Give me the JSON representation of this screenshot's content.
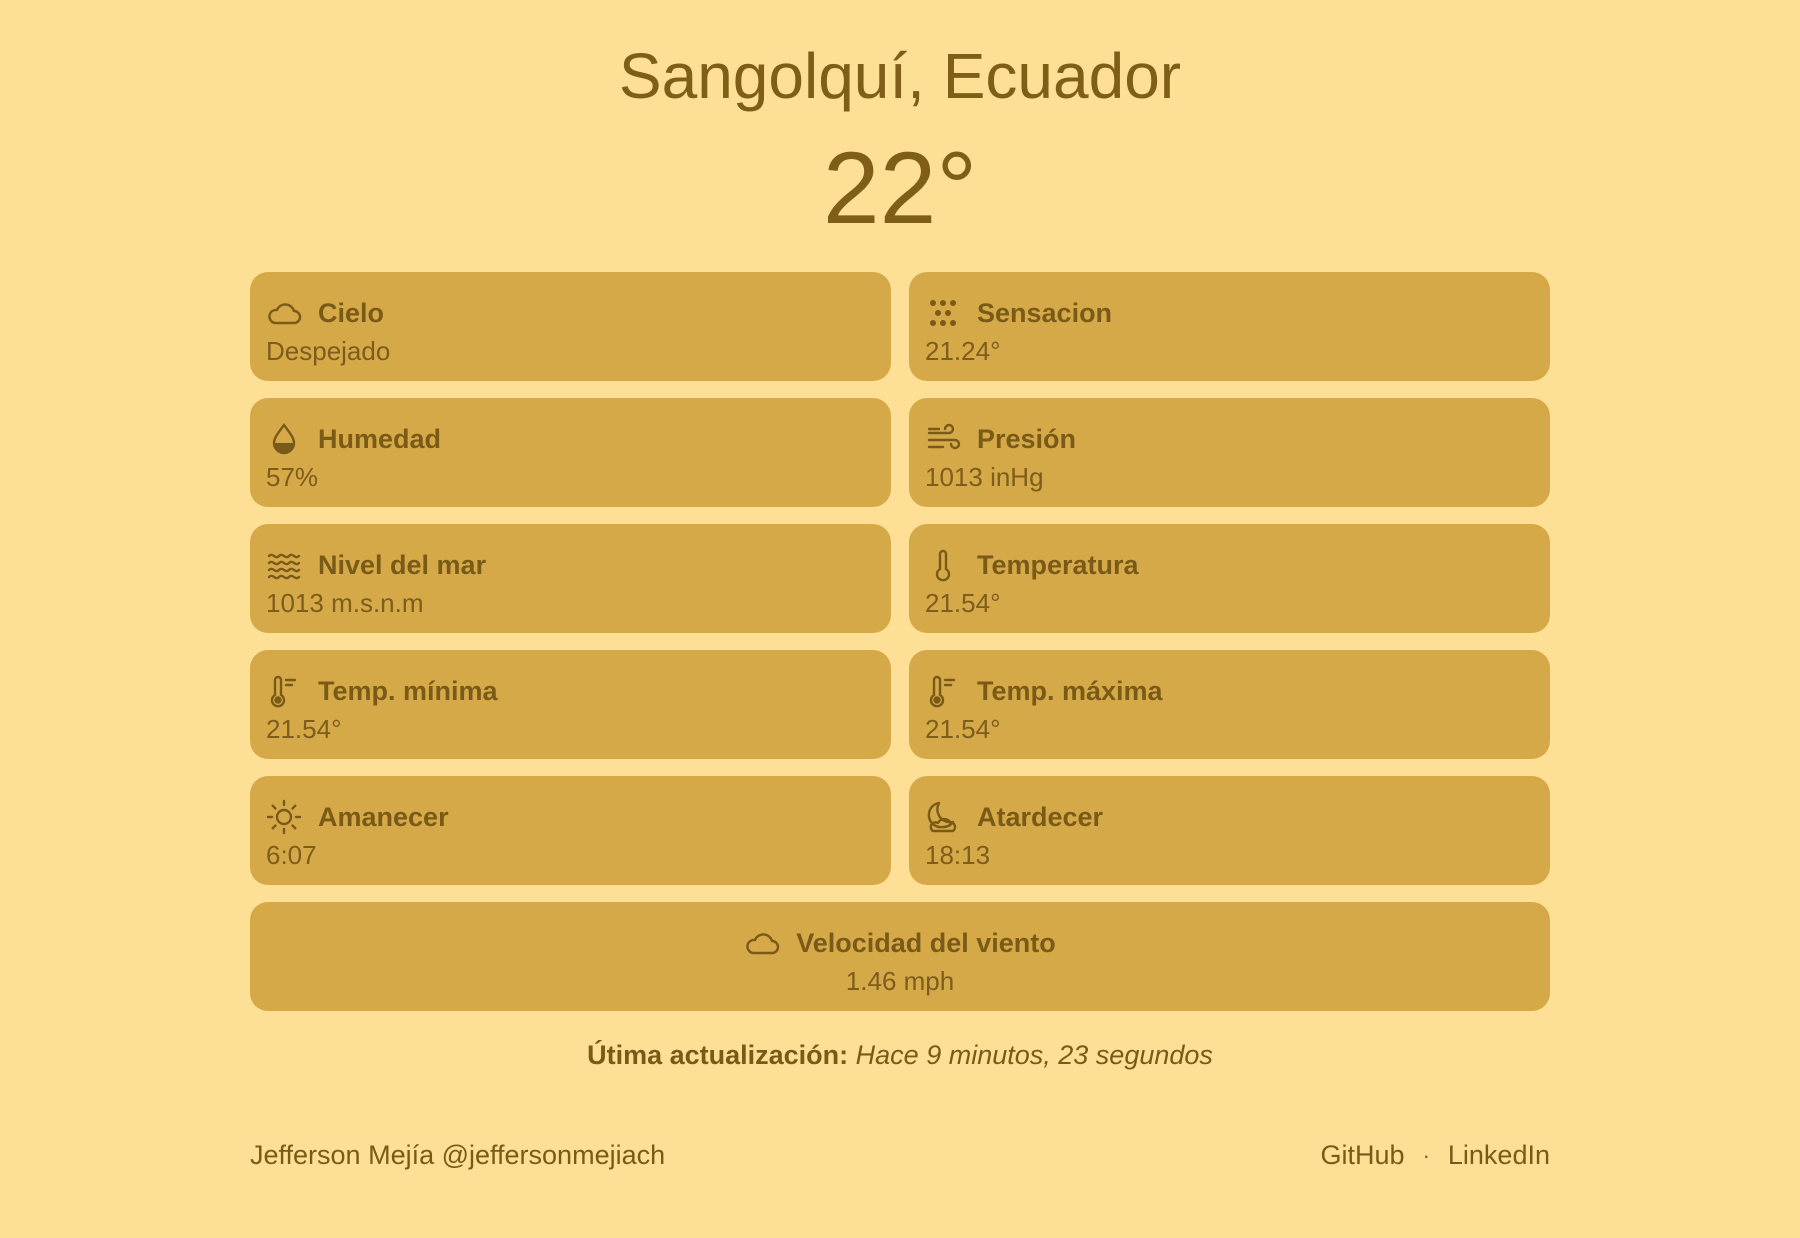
{
  "header": {
    "city": "Sangolquí, Ecuador",
    "temperature": "22°"
  },
  "cards": [
    {
      "title": "Cielo",
      "value": "Despejado",
      "icon": "cloud-icon"
    },
    {
      "title": "Sensacion",
      "value": "21.24°",
      "icon": "dots-icon"
    },
    {
      "title": "Humedad",
      "value": "57%",
      "icon": "droplet-icon"
    },
    {
      "title": "Presión",
      "value": "1013 inHg",
      "icon": "wind-icon"
    },
    {
      "title": "Nivel del mar",
      "value": "1013 m.s.n.m",
      "icon": "waves-icon"
    },
    {
      "title": "Temperatura",
      "value": "21.54°",
      "icon": "thermometer-icon"
    },
    {
      "title": "Temp. mínima",
      "value": "21.54°",
      "icon": "thermometer-low-icon"
    },
    {
      "title": "Temp. máxima",
      "value": "21.54°",
      "icon": "thermometer-high-icon"
    },
    {
      "title": "Amanecer",
      "value": "6:07",
      "icon": "sun-icon"
    },
    {
      "title": "Atardecer",
      "value": "18:13",
      "icon": "moon-cloud-icon"
    }
  ],
  "wind": {
    "title": "Velocidad del viento",
    "value": "1.46 mph",
    "icon": "cloud-icon"
  },
  "updated": {
    "label": "Útima actualización:",
    "value": "Hace 9 minutos, 23 segundos"
  },
  "footer": {
    "author": "Jefferson Mejía @jeffersonmejiach",
    "links": [
      "GitHub",
      "LinkedIn"
    ],
    "separator": "·"
  },
  "colors": {
    "background": "#fedf96",
    "card": "#d5a948",
    "text": "#7a5a17"
  }
}
